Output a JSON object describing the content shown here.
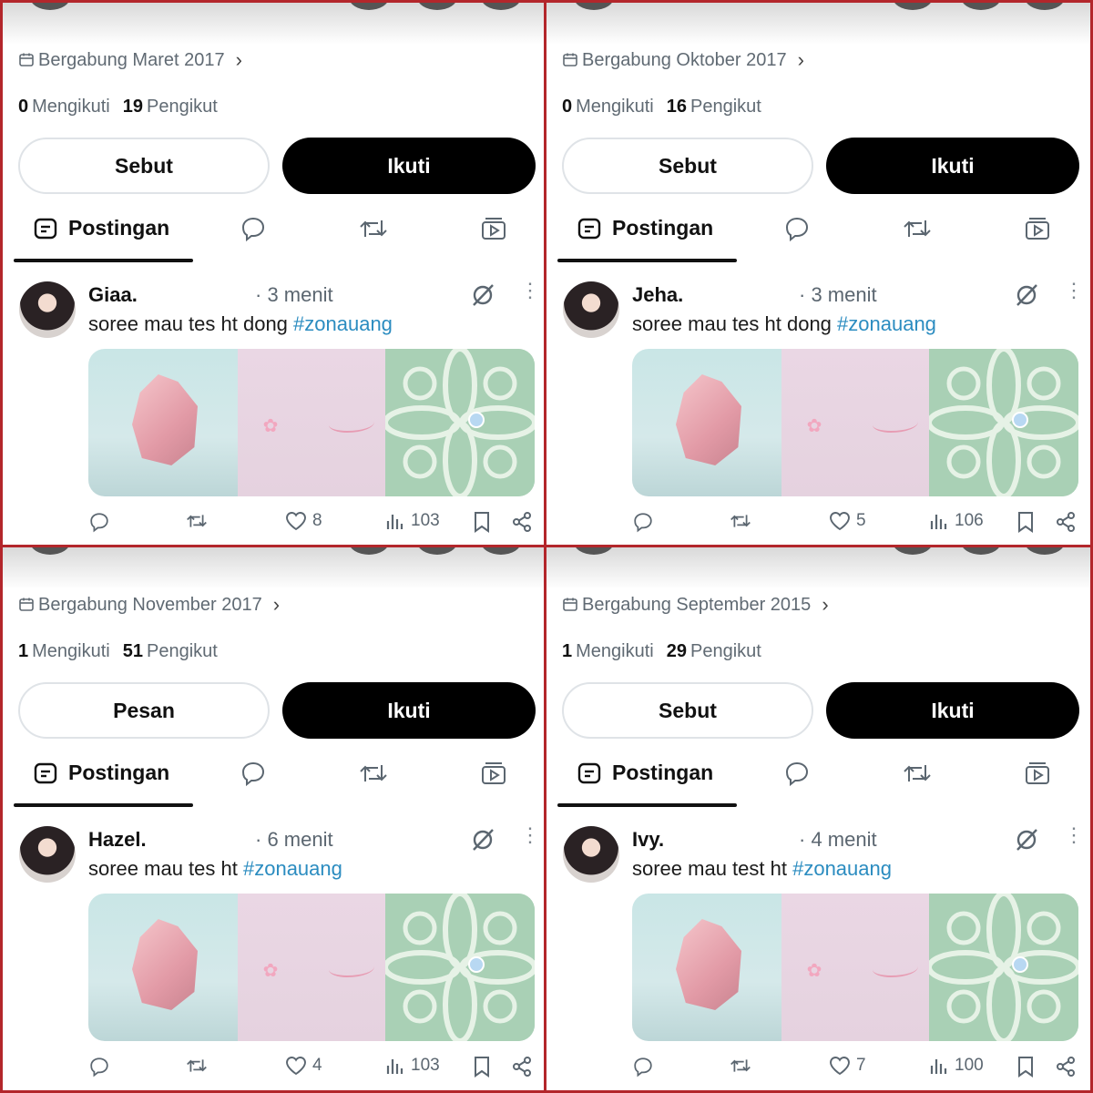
{
  "panels": [
    {
      "joined": "Bergabung Maret 2017",
      "following_count": "0",
      "following_label": "Mengikuti",
      "followers_count": "19",
      "followers_label": "Pengikut",
      "secondary_button": "Sebut",
      "primary_button": "Ikuti",
      "tab_posts": "Postingan",
      "tweet": {
        "name": "Giaa.",
        "time": "· 3 menit",
        "text": "soree mau tes ht dong ",
        "hashtag": "#zonauang",
        "likes": "8",
        "views": "103"
      }
    },
    {
      "joined": "Bergabung Oktober 2017",
      "following_count": "0",
      "following_label": "Mengikuti",
      "followers_count": "16",
      "followers_label": "Pengikut",
      "secondary_button": "Sebut",
      "primary_button": "Ikuti",
      "tab_posts": "Postingan",
      "tweet": {
        "name": "Jeha.",
        "time": "· 3 menit",
        "text": "soree mau tes ht dong ",
        "hashtag": "#zonauang",
        "likes": "5",
        "views": "106"
      }
    },
    {
      "joined": "Bergabung November 2017",
      "following_count": "1",
      "following_label": "Mengikuti",
      "followers_count": "51",
      "followers_label": "Pengikut",
      "secondary_button": "Pesan",
      "primary_button": "Ikuti",
      "tab_posts": "Postingan",
      "tweet": {
        "name": "Hazel.",
        "time": "· 6 menit",
        "text": "soree mau tes ht ",
        "hashtag": "#zonauang",
        "likes": "4",
        "views": "103"
      }
    },
    {
      "joined": "Bergabung September 2015",
      "following_count": "1",
      "following_label": "Mengikuti",
      "followers_count": "29",
      "followers_label": "Pengikut",
      "secondary_button": "Sebut",
      "primary_button": "Ikuti",
      "tab_posts": "Postingan",
      "tweet": {
        "name": "Ivy.",
        "time": "· 4 menit",
        "text": "soree mau test ht ",
        "hashtag": "#zonauang",
        "likes": "7",
        "views": "100"
      }
    }
  ],
  "icons": {
    "calendar": "calendar-icon",
    "chevron": "chevron-right-icon",
    "posts_tab": "posts-icon",
    "replies_tab": "reply-icon",
    "reposts_tab": "repost-icon",
    "media_tab": "media-icon",
    "mute": "mute-icon",
    "more": "more-icon",
    "like": "heart-icon",
    "views": "views-icon",
    "bookmark": "bookmark-icon",
    "share": "share-icon"
  },
  "colors": {
    "accent_link": "#2b8cc0",
    "panel_border": "#b3262b",
    "primary_button": "#000000"
  }
}
